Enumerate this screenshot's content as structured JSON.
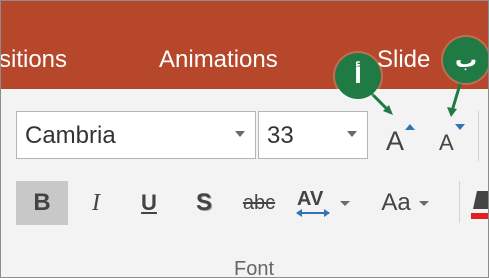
{
  "ribbon": {
    "tabs": [
      {
        "label": "sitions"
      },
      {
        "label": "Animations"
      },
      {
        "label": "Slide"
      }
    ]
  },
  "font_group": {
    "font_name": "Cambria",
    "font_size": "33",
    "buttons": {
      "bold": "B",
      "italic": "I",
      "underline": "U",
      "shadow": "S",
      "strikethrough": "abc",
      "char_spacing": "AV",
      "change_case": "Aa"
    },
    "group_label": "Font"
  },
  "callouts": [
    {
      "label": "أ"
    },
    {
      "label": "ب"
    }
  ],
  "colors": {
    "ribbon": "#b7472a",
    "callout": "#1f7a43",
    "font_color_red": "#e02020",
    "arrow_blue": "#2e75b6"
  },
  "icons": {
    "grow_font": "grow-font-icon",
    "shrink_font": "shrink-font-icon",
    "char_spacing": "character-spacing-icon",
    "font_color": "font-color-icon"
  }
}
